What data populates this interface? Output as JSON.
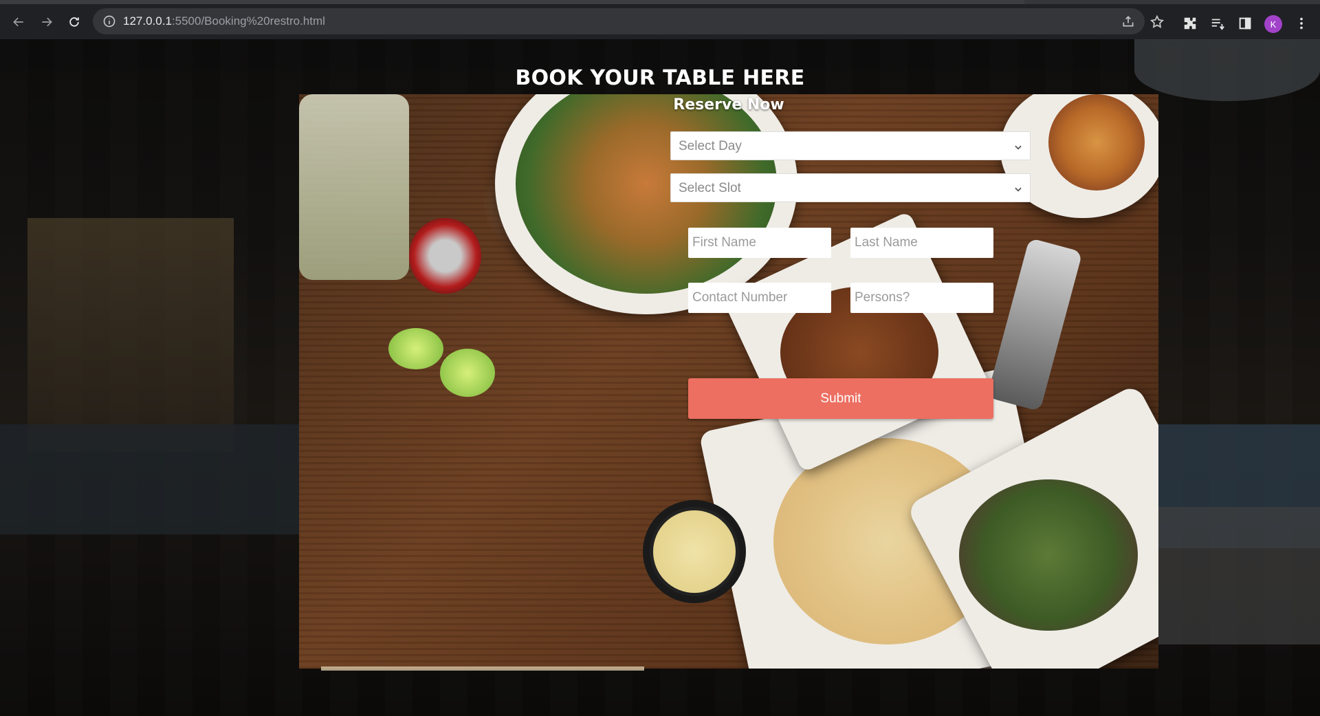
{
  "browser": {
    "url_host": "127.0.0.1",
    "url_rest": ":5500/Booking%20restro.html",
    "avatar_letter": "K",
    "icons": [
      "back-arrow-icon",
      "forward-arrow-icon",
      "reload-icon",
      "info-icon",
      "share-icon",
      "star-icon",
      "extensions-puzzle-icon",
      "reading-list-icon",
      "side-panel-icon",
      "kebab-menu-icon"
    ]
  },
  "page": {
    "heading": "BOOK YOUR TABLE HERE",
    "form": {
      "title": "Reserve Now",
      "day_select": "Select Day",
      "slot_select": "Select Slot",
      "first_name_placeholder": "First Name",
      "last_name_placeholder": "Last Name",
      "contact_placeholder": "Contact Number",
      "persons_placeholder": "Persons?",
      "submit_label": "Submit"
    }
  },
  "colors": {
    "submit_bg": "#ec6f61",
    "chrome_bg": "#202124",
    "omnibox_bg": "#35363a",
    "avatar_bg": "#a142c9"
  }
}
